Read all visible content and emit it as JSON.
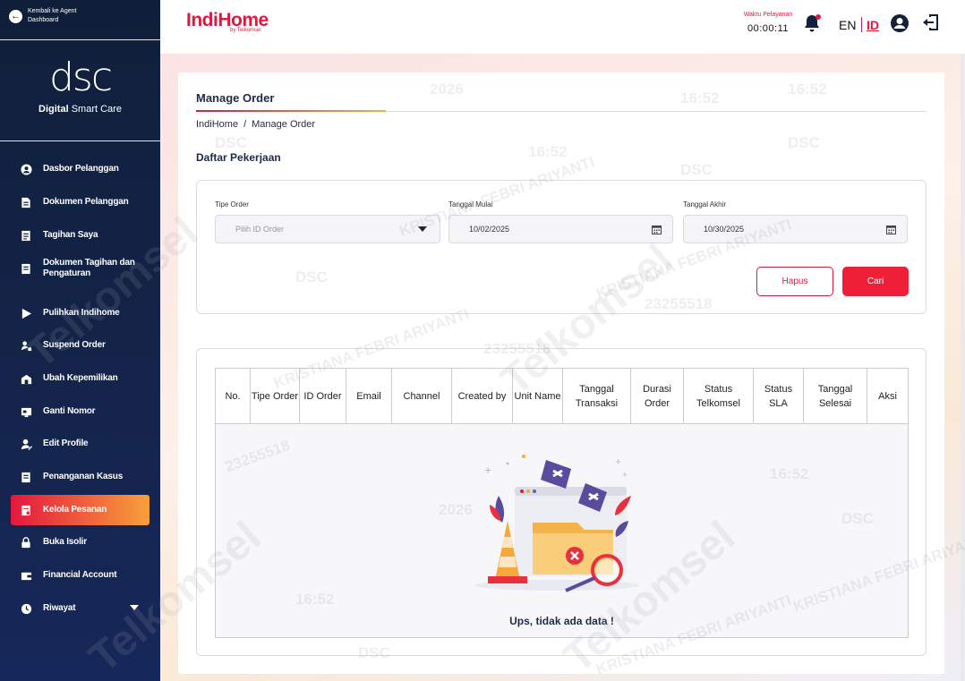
{
  "sidebar": {
    "back_label": "Kembali ke Agent Dashboard",
    "logo_mark": "dsc",
    "logo_sub_bold": "Digital",
    "logo_sub_rest": " Smart Care",
    "items": [
      {
        "label": "Dasbor Pelanggan",
        "icon": "user-circle-icon"
      },
      {
        "label": "Dokumen Pelanggan",
        "icon": "document-icon"
      },
      {
        "label": "Tagihan Saya",
        "icon": "bill-icon"
      },
      {
        "label": "Dokumen Tagihan dan Pengaturan",
        "icon": "bill-settings-icon"
      },
      {
        "label": "Pulihkan Indihome",
        "icon": "play-icon"
      },
      {
        "label": "Suspend Order",
        "icon": "suspend-icon"
      },
      {
        "label": "Ubah Kepemilikan",
        "icon": "ownership-icon"
      },
      {
        "label": "Ganti Nomor",
        "icon": "phone-number-icon"
      },
      {
        "label": "Edit Profile",
        "icon": "edit-profile-icon"
      },
      {
        "label": "Penanganan Kasus",
        "icon": "case-icon"
      },
      {
        "label": "Kelola Pesanan",
        "icon": "order-icon"
      },
      {
        "label": "Buka Isolir",
        "icon": "lock-icon"
      },
      {
        "label": "Financial Account",
        "icon": "wallet-icon"
      },
      {
        "label": "Riwayat",
        "icon": "history-icon"
      }
    ],
    "active_index": 10
  },
  "header": {
    "brand": "IndiHome",
    "brand_by": "by Telkomsel",
    "timer_label": "Waktu Pelayanan",
    "timer_value": "00:00:11",
    "lang_en": "EN",
    "lang_id": "ID"
  },
  "main": {
    "title": "Manage Order",
    "breadcrumb": [
      "IndiHome",
      "/",
      "Manage Order"
    ],
    "section_title": "Daftar Pekerjaan",
    "filters": {
      "order_type_label": "Tipe Order",
      "order_type_placeholder": "Pilih ID Order",
      "start_label": "Tanggal Mulai",
      "start_value": "10/02/2025",
      "end_label": "Tanggal Akhir",
      "end_value": "10/30/2025",
      "clear_label": "Hapus",
      "search_label": "Cari"
    },
    "table": {
      "columns": [
        "No.",
        "Tipe Order",
        "ID Order",
        "Email",
        "Channel",
        "Created by",
        "Unit Name",
        "Tanggal Transaksi",
        "Durasi Order",
        "Status Telkomsel",
        "Status SLA",
        "Tanggal Selesai",
        "Aksi"
      ],
      "empty_text": "Ups, tidak ada data !"
    }
  },
  "colors": {
    "accent": "#e3173e",
    "gradient_end": "#f8a03c",
    "sidebar": "#0f1f3a"
  }
}
